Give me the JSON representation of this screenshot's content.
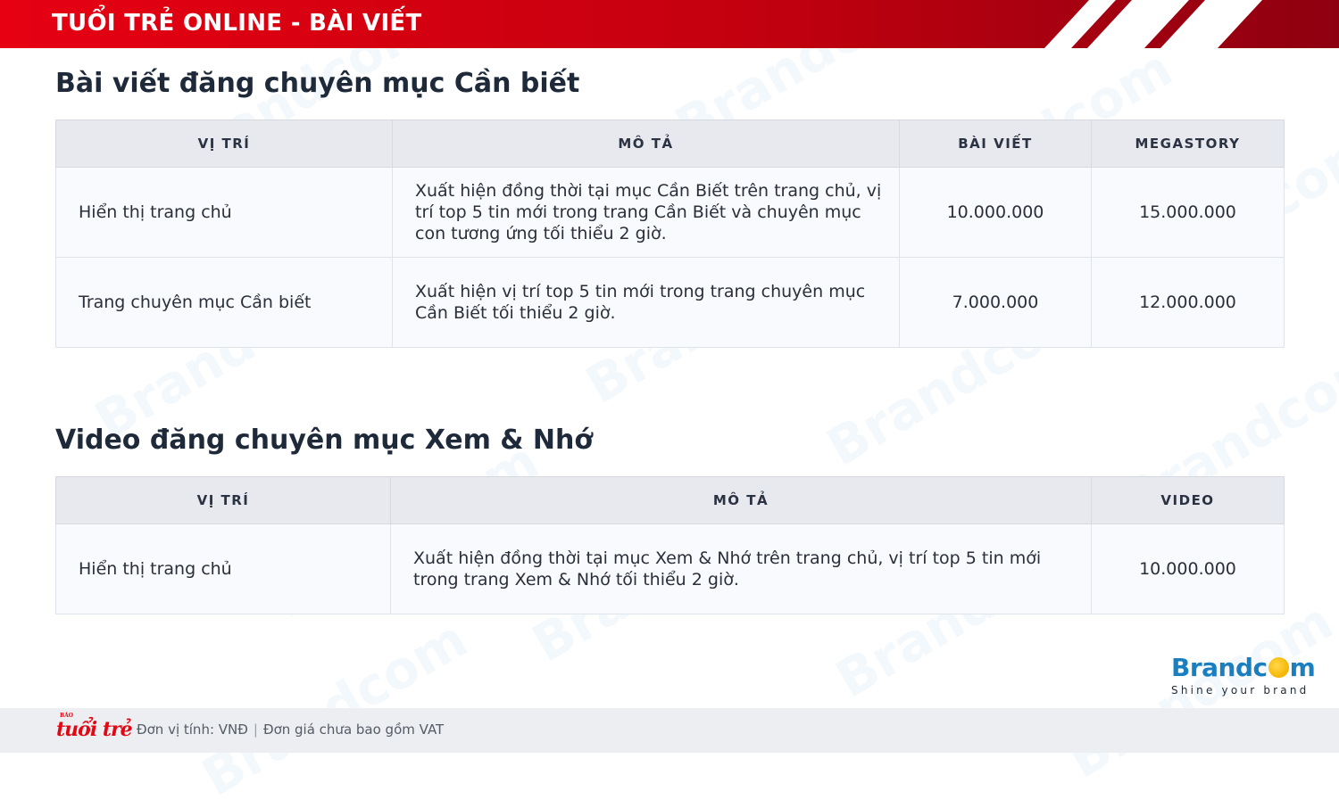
{
  "header": {
    "title": "TUỔI TRẺ ONLINE - BÀI VIẾT"
  },
  "section1": {
    "title": "Bài viết đăng chuyên mục Cần biết",
    "columns": [
      "VỊ TRÍ",
      "MÔ TẢ",
      "BÀI VIẾT",
      "MEGASTORY"
    ],
    "rows": [
      {
        "position": "Hiển thị trang chủ",
        "description": "Xuất hiện đồng thời tại mục Cần Biết trên trang chủ, vị trí top 5 tin mới trong trang Cần Biết và chuyên mục con tương ứng tối thiểu 2 giờ.",
        "article_price": "10.000.000",
        "megastory_price": "15.000.000"
      },
      {
        "position": "Trang chuyên mục Cần biết",
        "description": "Xuất hiện vị trí top 5 tin mới trong trang chuyên mục Cần Biết tối thiểu 2 giờ.",
        "article_price": "7.000.000",
        "megastory_price": "12.000.000"
      }
    ]
  },
  "section2": {
    "title": "Video đăng chuyên mục Xem & Nhớ",
    "columns": [
      "VỊ TRÍ",
      "MÔ TẢ",
      "VIDEO"
    ],
    "rows": [
      {
        "position": "Hiển thị trang chủ",
        "description": "Xuất hiện đồng thời tại mục Xem & Nhớ trên trang chủ, vị trí top 5 tin mới trong trang Xem & Nhớ tối thiểu 2 giờ.",
        "video_price": "10.000.000"
      }
    ]
  },
  "footer": {
    "logo_small": "BÁO",
    "logo_text": "tuổi trẻ",
    "unit_note": "Đơn vị tính: VNĐ",
    "separator": "|",
    "vat_note": "Đơn giá chưa bao gồm VAT"
  },
  "brand": {
    "name_part1": "Brandc",
    "name_part2": "m",
    "slogan": "Shine your brand"
  },
  "watermark": "Brandcom",
  "colors": {
    "header_red": "#e60012",
    "brand_blue": "#1a7fc1",
    "brand_yellow": "#f5b400",
    "table_header_bg": "#e7e9ee"
  }
}
